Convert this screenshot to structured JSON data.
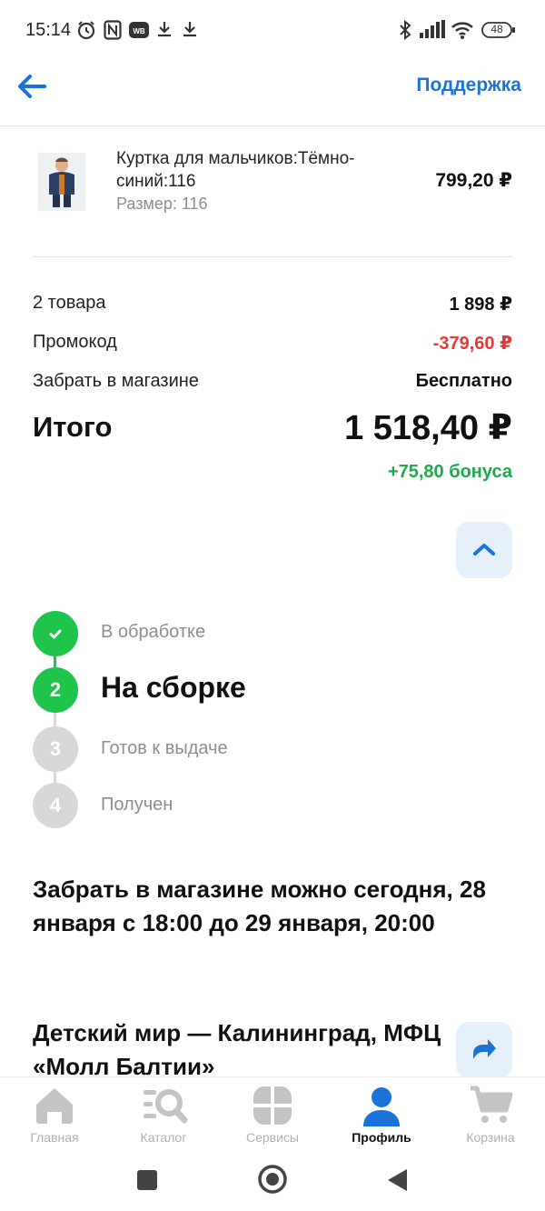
{
  "status_bar": {
    "time": "15:14",
    "battery": "48"
  },
  "header": {
    "back_label": "Назад",
    "support_label": "Поддержка"
  },
  "product": {
    "name": "Куртка для мальчиков:Тёмно-синий:116",
    "size": "Размер: 116",
    "price": "799,20 ₽"
  },
  "summary": {
    "rows": [
      {
        "label": "2 товара",
        "value": "1 898 ₽"
      },
      {
        "label": "Промокод",
        "value": "-379,60 ₽"
      },
      {
        "label": "Забрать в магазине",
        "value": "Бесплатно"
      }
    ],
    "total_label": "Итого",
    "total_value": "1 518,40 ₽",
    "bonus": "+75,80 бонуса"
  },
  "steps": [
    {
      "label": "В обработке",
      "state": "done"
    },
    {
      "num": "2",
      "label": "На сборке",
      "state": "current"
    },
    {
      "num": "3",
      "label": "Готов к выдаче",
      "state": "pending"
    },
    {
      "num": "4",
      "label": "Получен",
      "state": "pending"
    }
  ],
  "pickup_text": "Забрать в магазине можно сегодня, 28 января с 18:00 до 29 января, 20:00",
  "store_name": "Детский мир — Калининград, МФЦ «Молл Балтии»",
  "bottom_nav": [
    {
      "label": "Главная",
      "icon": "home-icon"
    },
    {
      "label": "Каталог",
      "icon": "catalog-search-icon"
    },
    {
      "label": "Сервисы",
      "icon": "services-icon"
    },
    {
      "label": "Профиль",
      "icon": "profile-icon",
      "active": true
    },
    {
      "label": "Корзина",
      "icon": "cart-icon"
    }
  ],
  "colors": {
    "accent": "#1a73d9",
    "success": "#1fc44b",
    "discount": "#e53935",
    "bonus": "#1bab4a"
  }
}
